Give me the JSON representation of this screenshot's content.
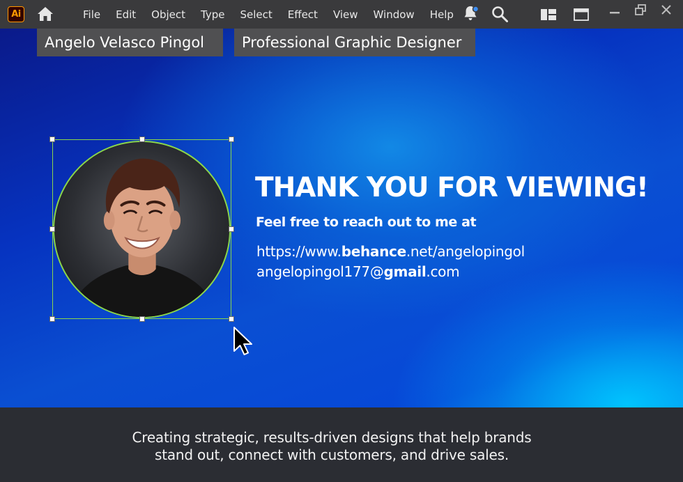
{
  "app": {
    "logo_text": "Ai",
    "brand_color": "#ff9a00",
    "selection_color": "#8bd64a"
  },
  "menu": {
    "items": [
      "File",
      "Edit",
      "Object",
      "Type",
      "Select",
      "Effect",
      "View",
      "Window",
      "Help"
    ]
  },
  "toolbar_icons": [
    "home-icon",
    "notification-bell-icon",
    "search-icon",
    "workspace-switcher-icon",
    "panel-layout-icon",
    "minimize-icon",
    "restore-icon",
    "close-icon"
  ],
  "canvas": {
    "name_label": "Angelo Velasco Pingol",
    "role_label": "Professional Graphic Designer",
    "headline": "THANK YOU FOR VIEWING!",
    "subline": "Feel free to reach out to me at",
    "behance": {
      "prefix": "https://www.",
      "bold": "behance",
      "suffix": ".net/angelopingol"
    },
    "email": {
      "prefix": "angelopingol177@",
      "bold": "gmail",
      "suffix": ".com"
    },
    "gradient_colors": [
      "#0a1a8a",
      "#0633c0",
      "#00c8ff"
    ]
  },
  "footer": {
    "line1": "Creating strategic, results-driven designs that help brands",
    "line2": "stand out, connect with customers, and drive sales."
  }
}
